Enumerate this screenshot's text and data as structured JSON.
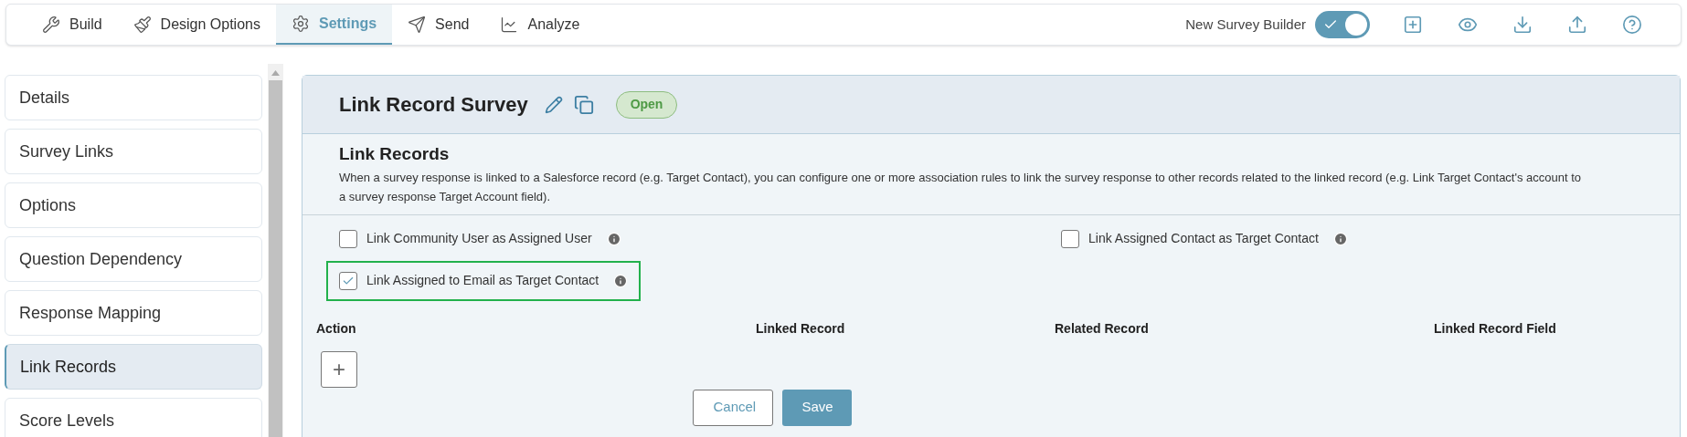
{
  "toolbar": {
    "tabs": [
      {
        "label": "Build",
        "selected": false
      },
      {
        "label": "Design Options",
        "selected": false
      },
      {
        "label": "Settings",
        "selected": true
      },
      {
        "label": "Send",
        "selected": false
      },
      {
        "label": "Analyze",
        "selected": false
      }
    ],
    "toggle": {
      "label": "New Survey Builder",
      "on": true
    }
  },
  "sidebar": {
    "items": [
      {
        "label": "Details",
        "selected": false
      },
      {
        "label": "Survey Links",
        "selected": false
      },
      {
        "label": "Options",
        "selected": false
      },
      {
        "label": "Question Dependency",
        "selected": false
      },
      {
        "label": "Response Mapping",
        "selected": false
      },
      {
        "label": "Link Records",
        "selected": true
      },
      {
        "label": "Score Levels",
        "selected": false
      }
    ]
  },
  "header": {
    "title": "Link Record Survey",
    "status": "Open"
  },
  "section": {
    "title": "Link Records",
    "description": "When a survey response is linked to a Salesforce record (e.g. Target Contact), you can configure one or more association rules to link the survey response to other records related to the linked record (e.g. Link Target Contact's account to a survey response Target Account field)."
  },
  "options": [
    {
      "label": "Link Community User as Assigned User",
      "checked": false,
      "highlighted": false
    },
    {
      "label": "Link Assigned Contact as Target Contact",
      "checked": false,
      "highlighted": false
    },
    {
      "label": "Link Assigned to Email as Target Contact",
      "checked": true,
      "highlighted": true
    }
  ],
  "table": {
    "columns": [
      "Action",
      "Linked Record",
      "Related Record",
      "Linked Record Field"
    ]
  },
  "add_button": "+",
  "buttons": [
    "Cancel",
    "Save"
  ]
}
